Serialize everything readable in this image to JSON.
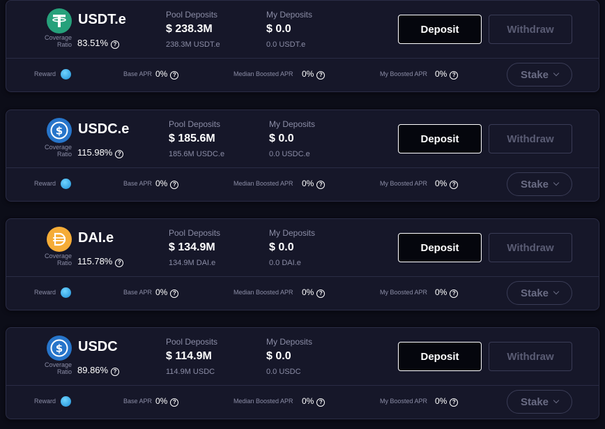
{
  "pools": [
    {
      "token": "USDT.e",
      "icon": "tether-icon",
      "icon_color": "#26a17b",
      "coverage_label": "Coverage Ratio",
      "coverage_value": "83.51%",
      "pool_deposits_label": "Pool Deposits",
      "pool_deposits_value": "$ 238.3M",
      "pool_deposits_sub": "238.3M USDT.e",
      "my_deposits_label": "My Deposits",
      "my_deposits_value": "$ 0.0",
      "my_deposits_sub": "0.0 USDT.e",
      "deposit_label": "Deposit",
      "withdraw_label": "Withdraw",
      "reward_label": "Reward",
      "base_apr_label": "Base APR",
      "base_apr_value": "0%",
      "median_boosted_apr_label": "Median Boosted APR",
      "median_boosted_apr_value": "0%",
      "my_boosted_apr_label": "My Boosted APR",
      "my_boosted_apr_value": "0%",
      "stake_label": "Stake"
    },
    {
      "token": "USDC.e",
      "icon": "usdc-icon",
      "icon_color": "#2775ca",
      "coverage_label": "Coverage Ratio",
      "coverage_value": "115.98%",
      "pool_deposits_label": "Pool Deposits",
      "pool_deposits_value": "$ 185.6M",
      "pool_deposits_sub": "185.6M USDC.e",
      "my_deposits_label": "My Deposits",
      "my_deposits_value": "$ 0.0",
      "my_deposits_sub": "0.0 USDC.e",
      "deposit_label": "Deposit",
      "withdraw_label": "Withdraw",
      "reward_label": "Reward",
      "base_apr_label": "Base APR",
      "base_apr_value": "0%",
      "median_boosted_apr_label": "Median Boosted APR",
      "median_boosted_apr_value": "0%",
      "my_boosted_apr_label": "My Boosted APR",
      "my_boosted_apr_value": "0%",
      "stake_label": "Stake"
    },
    {
      "token": "DAI.e",
      "icon": "dai-icon",
      "icon_color": "#f5ac37",
      "coverage_label": "Coverage Ratio",
      "coverage_value": "115.78%",
      "pool_deposits_label": "Pool Deposits",
      "pool_deposits_value": "$ 134.9M",
      "pool_deposits_sub": "134.9M DAI.e",
      "my_deposits_label": "My Deposits",
      "my_deposits_value": "$ 0.0",
      "my_deposits_sub": "0.0 DAI.e",
      "deposit_label": "Deposit",
      "withdraw_label": "Withdraw",
      "reward_label": "Reward",
      "base_apr_label": "Base APR",
      "base_apr_value": "0%",
      "median_boosted_apr_label": "Median Boosted APR",
      "median_boosted_apr_value": "0%",
      "my_boosted_apr_label": "My Boosted APR",
      "my_boosted_apr_value": "0%",
      "stake_label": "Stake"
    },
    {
      "token": "USDC",
      "icon": "usdc-icon",
      "icon_color": "#2775ca",
      "coverage_label": "Coverage Ratio",
      "coverage_value": "89.86%",
      "pool_deposits_label": "Pool Deposits",
      "pool_deposits_value": "$ 114.9M",
      "pool_deposits_sub": "114.9M USDC",
      "my_deposits_label": "My Deposits",
      "my_deposits_value": "$ 0.0",
      "my_deposits_sub": "0.0 USDC",
      "deposit_label": "Deposit",
      "withdraw_label": "Withdraw",
      "reward_label": "Reward",
      "base_apr_label": "Base APR",
      "base_apr_value": "0%",
      "median_boosted_apr_label": "Median Boosted APR",
      "median_boosted_apr_value": "0%",
      "my_boosted_apr_label": "My Boosted APR",
      "my_boosted_apr_value": "0%",
      "stake_label": "Stake"
    }
  ],
  "help_glyph": "?",
  "colors": {
    "background": "#0c0d18",
    "card": "#161729",
    "border": "#2a2c45",
    "muted_text": "#8b8da6",
    "reward_token": "#1f8fd6"
  }
}
